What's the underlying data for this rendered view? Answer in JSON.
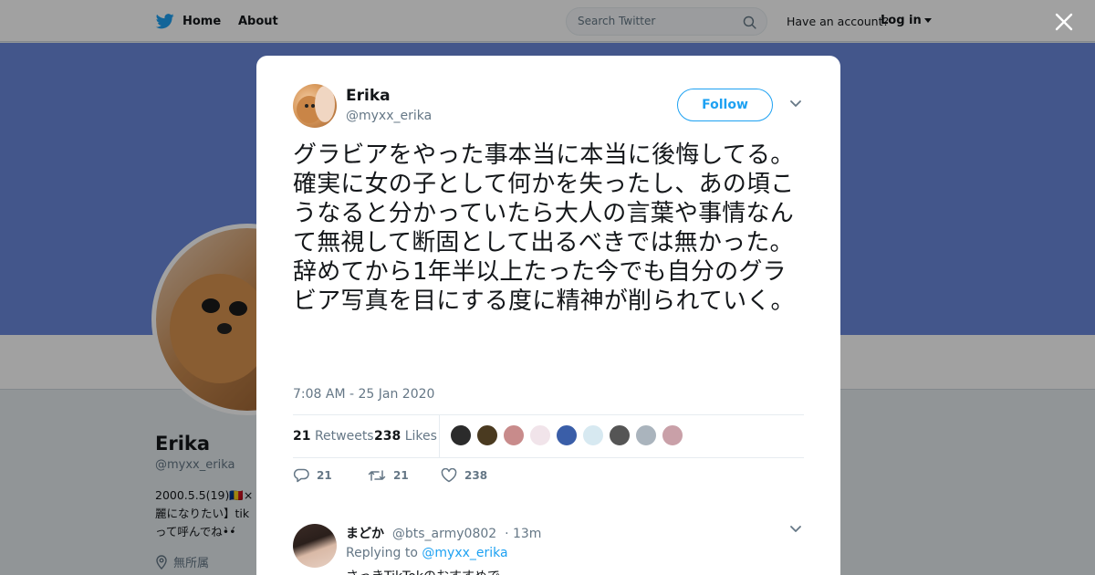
{
  "nav": {
    "home_label": "Home",
    "about_label": "About",
    "search_placeholder": "Search Twitter",
    "have_account": "Have an account?",
    "login_label": "Log in"
  },
  "profile": {
    "name": "Erika",
    "handle": "@myxx_erika",
    "bio_line1": "2000.5.5(19)🇷🇴×",
    "bio_line2": "麗になりたい】tik",
    "bio_line3": "って呼んでね•̀•́",
    "location": "無所属"
  },
  "tweet": {
    "author_name": "Erika",
    "author_handle": "@myxx_erika",
    "follow_label": "Follow",
    "text": "グラビアをやった事本当に本当に後悔してる。確実に女の子として何かを失ったし、あの頃こうなると分かっていたら大人の言葉や事情なんて無視して断固として出るべきでは無かった。\n辞めてから1年半以上たった今でも自分のグラビア写真を目にする度に精神が削られていく。",
    "timestamp": "7:08 AM - 25 Jan 2020",
    "retweets_count": "21",
    "retweets_label": "Retweets",
    "likes_count": "238",
    "likes_label": "Likes",
    "reply_count": "21",
    "retweet_count": "21",
    "like_count": "238",
    "likers": [
      "#2b2b2b",
      "#4a3a20",
      "#c88b8b",
      "#f1e4ea",
      "#3a5ea8",
      "#d7e9f1",
      "#555555",
      "#aab4bd",
      "#c9a0a8"
    ]
  },
  "reply": {
    "name": "まどか",
    "handle": "@bts_army0802",
    "time": "· 13m",
    "replying_prefix": "Replying to",
    "replying_to": "@myxx_erika",
    "text": "さっきTikTokのおすすめで"
  },
  "colors": {
    "brand_blue": "#1da1f2",
    "banner": "#6a89dc",
    "text_secondary": "#657786"
  }
}
